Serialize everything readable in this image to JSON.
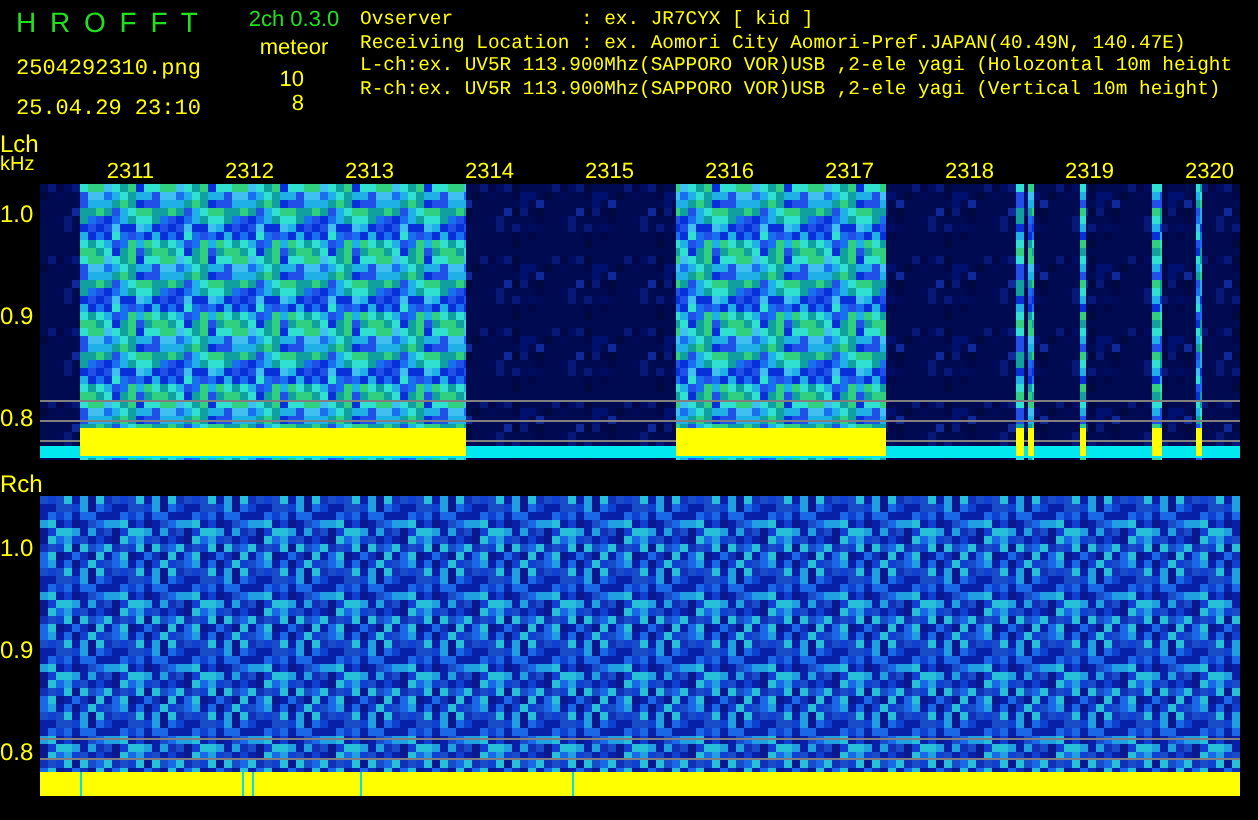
{
  "app": {
    "title": "H R O F F T",
    "version": "2ch 0.3.0"
  },
  "file_name": "2504292310.png",
  "datetime": "25.04.29 23:10",
  "meteor": {
    "label": "meteor",
    "counts": [
      "10",
      "8"
    ]
  },
  "info_lines": [
    "Ovserver           : ex. JR7CYX [ kid ]",
    "Receiving Location : ex. Aomori City Aomori-Pref.JAPAN(40.49N, 140.47E)",
    "L-ch:ex. UV5R 113.900Mhz(SAPPORO VOR)USB ,2-ele yagi (Holozontal 10m height",
    "R-ch:ex. UV5R 113.900Mhz(SAPPORO VOR)USB ,2-ele yagi (Vertical 10m height)"
  ],
  "panels": [
    {
      "kind": "lch",
      "label": "Lch",
      "unit": "kHz",
      "yticks": [
        "1.0",
        "0.9",
        "0.8"
      ],
      "times": [
        "2311",
        "2312",
        "2313",
        "2314",
        "2315",
        "2316",
        "2317",
        "2318",
        "2319",
        "2320"
      ]
    },
    {
      "kind": "rch",
      "label": "Rch",
      "yticks": [
        "1.0",
        "0.9",
        "0.8"
      ]
    }
  ]
}
